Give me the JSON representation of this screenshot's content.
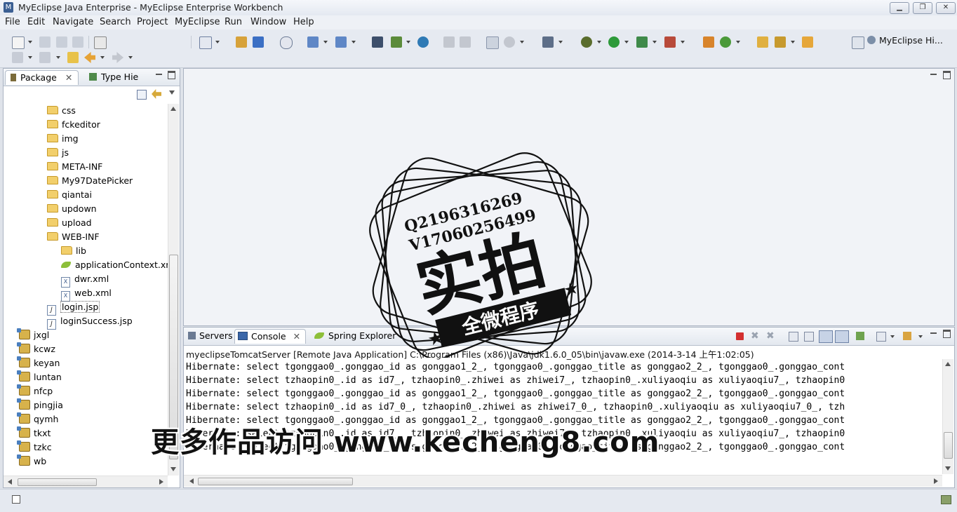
{
  "window": {
    "title": "MyEclipse Java Enterprise - MyEclipse Enterprise Workbench",
    "controls": [
      "minimize",
      "restore",
      "close"
    ]
  },
  "menubar": {
    "items": [
      "File",
      "Edit",
      "Navigate",
      "Search",
      "Project",
      "MyEclipse",
      "Run",
      "Window",
      "Help"
    ]
  },
  "toolbar": {
    "perspective_label": "MyEclipse Hi..."
  },
  "left_panel": {
    "tabs": [
      {
        "label": "Package",
        "active": true
      },
      {
        "label": "Type Hie",
        "active": false
      }
    ],
    "tree": [
      {
        "label": "css",
        "type": "folder",
        "depth": 2
      },
      {
        "label": "fckeditor",
        "type": "folder",
        "depth": 2
      },
      {
        "label": "img",
        "type": "folder",
        "depth": 2
      },
      {
        "label": "js",
        "type": "folder",
        "depth": 2
      },
      {
        "label": "META-INF",
        "type": "folder",
        "depth": 2
      },
      {
        "label": "My97DatePicker",
        "type": "folder",
        "depth": 2
      },
      {
        "label": "qiantai",
        "type": "folder",
        "depth": 2
      },
      {
        "label": "updown",
        "type": "folder",
        "depth": 2
      },
      {
        "label": "upload",
        "type": "folder",
        "depth": 2
      },
      {
        "label": "WEB-INF",
        "type": "folder",
        "depth": 2
      },
      {
        "label": "lib",
        "type": "folder",
        "depth": 3
      },
      {
        "label": "applicationContext.xml",
        "type": "spring",
        "depth": 3
      },
      {
        "label": "dwr.xml",
        "type": "xml",
        "depth": 3
      },
      {
        "label": "web.xml",
        "type": "xml",
        "depth": 3
      },
      {
        "label": "login.jsp",
        "type": "jsp",
        "depth": 2,
        "selected": true
      },
      {
        "label": "loginSuccess.jsp",
        "type": "jsp",
        "depth": 2
      },
      {
        "label": "jxgl",
        "type": "project",
        "depth": 1
      },
      {
        "label": "kcwz",
        "type": "project",
        "depth": 1
      },
      {
        "label": "keyan",
        "type": "project",
        "depth": 1
      },
      {
        "label": "luntan",
        "type": "project",
        "depth": 1
      },
      {
        "label": "nfcp",
        "type": "project",
        "depth": 1
      },
      {
        "label": "pingjia",
        "type": "project",
        "depth": 1
      },
      {
        "label": "qymh",
        "type": "project",
        "depth": 1
      },
      {
        "label": "tkxt",
        "type": "project",
        "depth": 1
      },
      {
        "label": "tzkc",
        "type": "project",
        "depth": 1
      },
      {
        "label": "wb",
        "type": "project",
        "depth": 1
      }
    ]
  },
  "console_panel": {
    "tabs": [
      {
        "label": "Servers",
        "active": false
      },
      {
        "label": "Console",
        "active": true
      },
      {
        "label": "Spring Explorer",
        "active": false
      }
    ],
    "header": "myeclipseTomcatServer [Remote Java Application] C:\\Program Files (x86)\\Java\\jdk1.6.0_05\\bin\\javaw.exe (2014-3-14 上午1:02:05)",
    "lines": [
      "Hibernate: select tgonggao0_.gonggao_id as gonggao1_2_, tgonggao0_.gonggao_title as gonggao2_2_, tgonggao0_.gonggao_cont",
      "Hibernate: select tzhaopin0_.id as id7_, tzhaopin0_.zhiwei as zhiwei7_, tzhaopin0_.xuliyaoqiu as xuliyaoqiu7_, tzhaopin0",
      "Hibernate: select tgonggao0_.gonggao_id as gonggao1_2_, tgonggao0_.gonggao_title as gonggao2_2_, tgonggao0_.gonggao_cont",
      "Hibernate: select tzhaopin0_.id as id7_0_, tzhaopin0_.zhiwei as zhiwei7_0_, tzhaopin0_.xuliyaoqiu as xuliyaoqiu7_0_, tzh",
      "Hibernate: select tgonggao0_.gonggao_id as gonggao1_2_, tgonggao0_.gonggao_title as gonggao2_2_, tgonggao0_.gonggao_cont",
      "Hibernate: select tzhaopin0_.id as id7_, tzhaopin0_.zhiwei as zhiwei7_, tzhaopin0_.xuliyaoqiu as xuliyaoqiu7_, tzhaopin0",
      "Hibernate: select tgonggao0_.gonggao_id as gonggao1_2_, tgonggao0_.gonggao_title as gonggao2_2_, tgonggao0_.gonggao_cont"
    ]
  },
  "overlay": {
    "url_watermark": "更多作品访问 www.kecheng8.com",
    "stamp_line1": "Q2196316269",
    "stamp_line2": "V17060256499",
    "stamp_main": "实拍",
    "stamp_banner": "全微程序"
  },
  "colors": {
    "accent": "#3b5f93",
    "terminate_red": "#d32f2f"
  }
}
